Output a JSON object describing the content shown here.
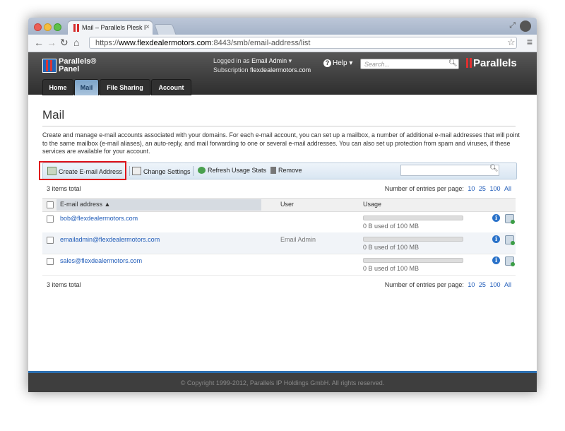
{
  "browser": {
    "tab_title": "Mail – Parallels Plesk Panel",
    "url_scheme": "https://",
    "url_host": "www.flexdealermotors.com",
    "url_path": ":8443/smb/email-address/list"
  },
  "header": {
    "logo_line1": "Parallels®",
    "logo_line2": "Panel",
    "logged_in_label": "Logged in as",
    "logged_in_user": "Email Admin",
    "subscription_label": "Subscription",
    "subscription_value": "flexdealermotors.com",
    "help_label": "Help",
    "search_placeholder": "Search...",
    "brand": "Parallels",
    "tabs": [
      {
        "label": "Home",
        "active": false
      },
      {
        "label": "Mail",
        "active": true
      },
      {
        "label": "File Sharing",
        "active": false
      },
      {
        "label": "Account",
        "active": false
      }
    ]
  },
  "page": {
    "title": "Mail",
    "description": "Create and manage e-mail accounts associated with your domains. For each e-mail account, you can set up a mailbox, a number of additional e-mail addresses that will point to the same mailbox (e-mail aliases), an auto-reply, and mail forwarding to one or several e-mail addresses. You can also set up protection from spam and viruses, if these services are available for your account."
  },
  "actions": {
    "create": "Create E-mail Address",
    "change_settings": "Change Settings",
    "refresh": "Refresh Usage Stats",
    "remove": "Remove"
  },
  "table": {
    "items_total": "3 items total",
    "per_page_label": "Number of entries per page:",
    "per_page_options": [
      "10",
      "25",
      "100",
      "All"
    ],
    "columns": {
      "email": "E-mail address ▲",
      "user": "User",
      "usage": "Usage"
    },
    "rows": [
      {
        "email": "bob@flexdealermotors.com",
        "user": "",
        "usage": "0 B used of 100 MB",
        "usage_fraction": 0
      },
      {
        "email": "emailadmin@flexdealermotors.com",
        "user": "Email Admin",
        "usage": "0 B used of 100 MB",
        "usage_fraction": 0
      },
      {
        "email": "sales@flexdealermotors.com",
        "user": "",
        "usage": "0 B used of 100 MB",
        "usage_fraction": 0
      }
    ]
  },
  "footer": {
    "copyright": "© Copyright 1999-2012, Parallels IP Holdings GmbH. All rights reserved."
  },
  "colors": {
    "link": "#1f5bb8",
    "highlight": "#e0131b",
    "brand_red": "#e03030",
    "footer_accent": "#2c6fb0"
  }
}
